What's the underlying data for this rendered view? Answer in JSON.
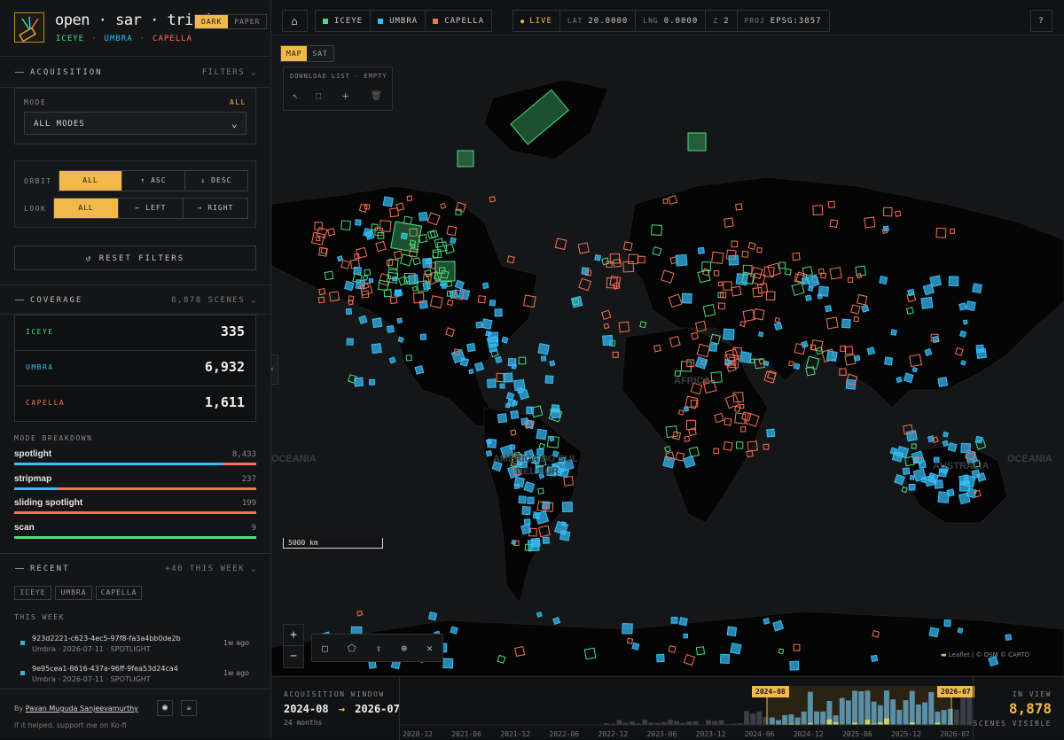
{
  "brand": {
    "title": "open · sar · triad",
    "sub": [
      "ICEYE",
      "·",
      "UMBRA",
      "·",
      "CAPELLA"
    ],
    "theme_dark": "DARK",
    "theme_paper": "PAPER"
  },
  "acquisition": {
    "title": "ACQUISITION",
    "filters": "FILTERS",
    "mode_label": "MODE",
    "mode_all": "ALL",
    "mode_value": "ALL MODES",
    "orbit_label": "ORBIT",
    "orbit": [
      "ALL",
      "↑ ASC",
      "↓ DESC"
    ],
    "look_label": "LOOK",
    "look": [
      "ALL",
      "← LEFT",
      "→ RIGHT"
    ],
    "reset": "↺ RESET FILTERS"
  },
  "coverage": {
    "title": "COVERAGE",
    "scenes": "8,878 SCENES",
    "rows": [
      {
        "name": "ICEYE",
        "value": "335"
      },
      {
        "name": "UMBRA",
        "value": "6,932"
      },
      {
        "name": "CAPELLA",
        "value": "1,611"
      }
    ],
    "breakdown_label": "MODE BREAKDOWN",
    "modes": [
      {
        "name": "spotlight",
        "count": "8,433",
        "fraction": 0.95
      },
      {
        "name": "stripmap",
        "count": "237",
        "fraction": 0.03
      },
      {
        "name": "sliding spotlight",
        "count": "199",
        "fraction": 0.02
      },
      {
        "name": "scan",
        "count": "9",
        "fraction": 0.001
      }
    ]
  },
  "recent": {
    "title": "RECENT",
    "count": "+40 THIS WEEK",
    "chips": [
      "ICEYE",
      "UMBRA",
      "CAPELLA"
    ],
    "week_label": "THIS WEEK",
    "items": [
      {
        "id": "923d2221-c623-4ec5-97f8-fa3a4bb0de2b",
        "meta": "Umbra · 2026-07-11 · SPOTLIGHT",
        "ago": "1w ago"
      },
      {
        "id": "9e95cea1-8616-437a-96ff-9fea53d24ca4",
        "meta": "Umbra · 2026-07-11 · SPOTLIGHT",
        "ago": "1w ago"
      }
    ]
  },
  "footer": {
    "by": "By",
    "author": "Pavan Muguda Sanjeevamurthy",
    "support": "if it helped, support me on Ko-fi"
  },
  "topbar": {
    "legend": [
      "ICEYE",
      "UMBRA",
      "CAPELLA"
    ],
    "live": "LIVE",
    "lat_label": "LAT",
    "lat": "20.0000",
    "lng_label": "LNG",
    "lng": "0.0000",
    "z_label": "Z",
    "z": "2",
    "proj_label": "PROJ",
    "proj": "EPSG:3857",
    "help": "?"
  },
  "map": {
    "layer_map": "MAP",
    "layer_sat": "SAT",
    "download": "DOWNLOAD LIST · EMPTY",
    "scale": "5000 km",
    "zoom_in": "+",
    "zoom_out": "−",
    "attribution": "Leaflet | © OSM © CARTO",
    "labels": [
      "OCEANIA",
      "OCEANIA",
      "AUSTRALIA",
      "AMÉRICA DO SUL",
      "DEL SUR",
      "ÁFRICA"
    ]
  },
  "timeline": {
    "title": "ACQUISITION WINDOW",
    "start": "2024-08",
    "arrow": "→",
    "end": "2026-07",
    "duration": "24 months",
    "handle_start": "2024-08",
    "handle_end": "2026-07",
    "ticks": [
      "2020-12",
      "2021-06",
      "2021-12",
      "2022-06",
      "2022-12",
      "2023-06",
      "2023-12",
      "2024-06",
      "2024-12",
      "2025-06",
      "2025-12",
      "2026-07"
    ],
    "in_view": "IN VIEW",
    "visible_count": "8,878",
    "visible_label": "SCENES VISIBLE"
  },
  "colors": {
    "iceye": "#4ade80",
    "umbra": "#38bdf8",
    "capella": "#f97352",
    "accent": "#f1b84a"
  }
}
